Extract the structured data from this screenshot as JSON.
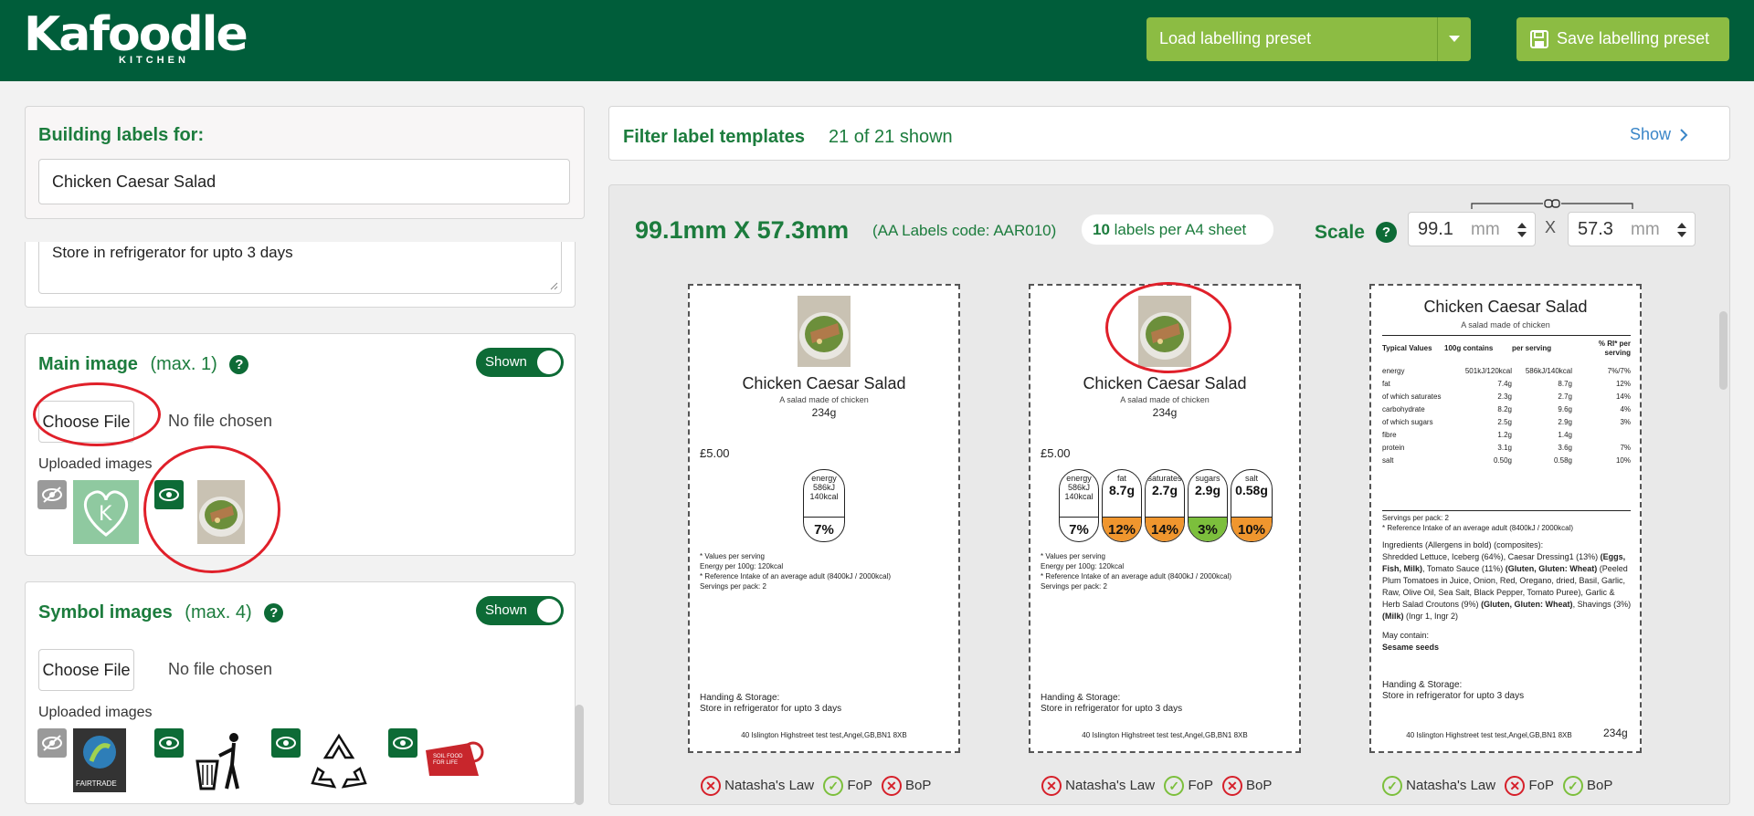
{
  "header": {
    "logo_text": "Kafoodle",
    "logo_sub": "KITCHEN",
    "load_preset_label": "Load labelling preset",
    "save_preset_label": "Save labelling preset"
  },
  "left": {
    "building_title": "Building labels for:",
    "recipe_name": "Chicken Caesar Salad",
    "storage_text": "Store in refrigerator for upto 3 days",
    "main_image": {
      "title": "Main image",
      "max": "(max. 1)",
      "toggle": "Shown",
      "choose_file": "Choose File",
      "no_file": "No file chosen",
      "uploaded": "Uploaded images"
    },
    "symbol_images": {
      "title": "Symbol images",
      "max": "(max. 4)",
      "toggle": "Shown",
      "choose_file": "Choose File",
      "no_file": "No file chosen",
      "uploaded": "Uploaded images",
      "fairtrade_text": "FAIRTRADE",
      "sol_text": "SOIL FOOD FOR LIFE"
    }
  },
  "filter": {
    "title": "Filter label templates",
    "count": "21 of 21 shown",
    "show": "Show"
  },
  "templates": {
    "size": "99.1mm X 57.3mm",
    "code": "(AA Labels code: AAR010)",
    "per_sheet_num": "10",
    "per_sheet_text": "labels per A4 sheet",
    "scale_label": "Scale",
    "width_value": "99.1",
    "height_value": "57.3",
    "unit": "mm",
    "x": "X"
  },
  "label_common": {
    "title": "Chicken Caesar Salad",
    "desc": "A salad made of chicken",
    "weight": "234g",
    "price": "£5.00",
    "values_note": "* Values per serving",
    "energy_note": "Energy per 100g: 120kcal",
    "ri_note": "* Reference Intake of an average adult (8400kJ / 2000kcal)",
    "servings": "Servings per pack: 2",
    "handling": "Handing & Storage:",
    "storage": "Store in refrigerator for upto 3 days",
    "address": "40 Islington Highstreet test test,Angel,GB,BN1 8XB"
  },
  "traffic": {
    "energy_top": "energy",
    "energy_kj": "586kJ",
    "energy_kcal": "140kcal",
    "energy_pct": "7%",
    "fat": "fat",
    "fat_val": "8.7g",
    "fat_pct": "12%",
    "sat": "saturates",
    "sat_val": "2.7g",
    "sat_pct": "14%",
    "sug": "sugars",
    "sug_val": "2.9g",
    "sug_pct": "3%",
    "salt": "salt",
    "salt_val": "0.58g",
    "salt_pct": "10%"
  },
  "nutrition": {
    "head": [
      "Typical Values",
      "100g contains",
      "per serving",
      "% RI* per serving"
    ],
    "rows": [
      [
        "energy",
        "501kJ/120kcal",
        "586kJ/140kcal",
        "7%/7%"
      ],
      [
        "fat",
        "7.4g",
        "8.7g",
        "12%"
      ],
      [
        "of which saturates",
        "2.3g",
        "2.7g",
        "14%"
      ],
      [
        "carbohydrate",
        "8.2g",
        "9.6g",
        "4%"
      ],
      [
        "of which sugars",
        "2.5g",
        "2.9g",
        "3%"
      ],
      [
        "fibre",
        "1.2g",
        "1.4g",
        ""
      ],
      [
        "protein",
        "3.1g",
        "3.6g",
        "7%"
      ],
      [
        "salt",
        "0.50g",
        "0.58g",
        "10%"
      ]
    ],
    "ingredients_title": "Ingredients (Allergens in bold) (composites):",
    "may_contain": "May contain:",
    "sesame": "Sesame seeds"
  },
  "status": {
    "natasha": "Natasha's Law",
    "fop": "FoP",
    "bop": "BoP"
  },
  "colors": {
    "header_green": "#005d3a",
    "button_green": "#8cbc43",
    "text_green": "#1c7c3d",
    "amber": "#f0962e",
    "traffic_green": "#7cbf3c",
    "error_red": "#e0202a"
  }
}
